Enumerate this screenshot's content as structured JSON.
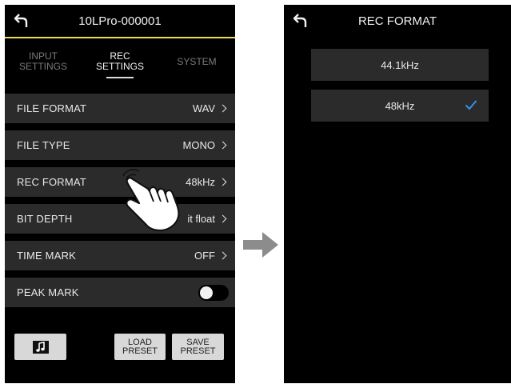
{
  "left": {
    "title": "10LPro-000001",
    "tabs": [
      {
        "line1": "INPUT",
        "line2": "SETTINGS",
        "active": false
      },
      {
        "line1": "REC",
        "line2": "SETTINGS",
        "active": true
      },
      {
        "line1": "SYSTEM",
        "line2": "",
        "active": false
      }
    ],
    "rows": [
      {
        "label": "FILE FORMAT",
        "value": "WAV"
      },
      {
        "label": "FILE TYPE",
        "value": "MONO"
      },
      {
        "label": "REC FORMAT",
        "value": "48kHz"
      },
      {
        "label": "BIT DEPTH",
        "value": "it float"
      },
      {
        "label": "TIME MARK",
        "value": "OFF"
      }
    ],
    "peak_mark": {
      "label": "PEAK MARK",
      "on": false
    },
    "buttons": {
      "music_icon": "music-note-icon",
      "load_line1": "LOAD",
      "load_line2": "PRESET",
      "save_line1": "SAVE",
      "save_line2": "PRESET"
    }
  },
  "right": {
    "title": "REC FORMAT",
    "options": [
      {
        "label": "44.1kHz",
        "selected": false
      },
      {
        "label": "48kHz",
        "selected": true
      }
    ]
  },
  "colors": {
    "accent_line": "#e8e04a",
    "check": "#3a8ee6",
    "row_bg": "#2b2b2b",
    "button_bg": "#d8d8d8"
  }
}
